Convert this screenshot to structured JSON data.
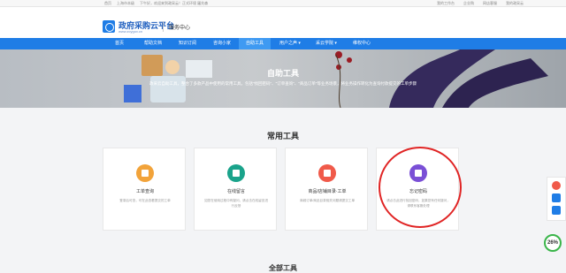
{
  "topbar": {
    "home": "首页",
    "region": "上海市本级",
    "greeting": "下午好，欢迎来到政采云！正式环境 屠先森",
    "links": [
      "我的工作台",
      "企业购",
      "网店客服",
      "我的政采云"
    ]
  },
  "header": {
    "brand": "政府采购云平台",
    "brand_sub": "www.zcygov.cn",
    "service": "服务中心"
  },
  "nav": {
    "items": [
      {
        "label": "首页"
      },
      {
        "label": "帮助文档"
      },
      {
        "label": "知识订阅"
      },
      {
        "label": "咨询小家"
      },
      {
        "label": "自助工具",
        "active": true
      },
      {
        "label": "用户之声 ▾"
      },
      {
        "label": "采云学院 ▾"
      },
      {
        "label": "维权中心"
      }
    ]
  },
  "banner": {
    "title": "自助工具",
    "desc": "政采云自助工具，整合了多款产品中使用的常用工具，包括\"找回密码\"、\"订单查询\"、\"商品订单\"等业务场景，将业务操作转化为查询付款提交的工单步骤"
  },
  "section": {
    "title": "常用工具",
    "next_title": "全部工具"
  },
  "cards": [
    {
      "name": "工单查询",
      "desc": "登录后可查，可在此查看提交的工单",
      "icon": "search-icon",
      "color": "#f2a33a"
    },
    {
      "name": "在线留言",
      "desc": "如您在使用过程中有疑问，请点击在线留言进行反馈",
      "icon": "clock-icon",
      "color": "#1aa38b"
    },
    {
      "name": "商品/店铺目录·工单",
      "desc": "商城订单/商品目录相关问题请提交工单",
      "icon": "store-icon",
      "color": "#f05a4a"
    },
    {
      "name": "忘记密码",
      "desc": "请点击此进行找回密码，如果您有任何疑问，请联系客服处理",
      "icon": "key-icon",
      "color": "#7a4fd6"
    }
  ],
  "progress_badge": "26%"
}
